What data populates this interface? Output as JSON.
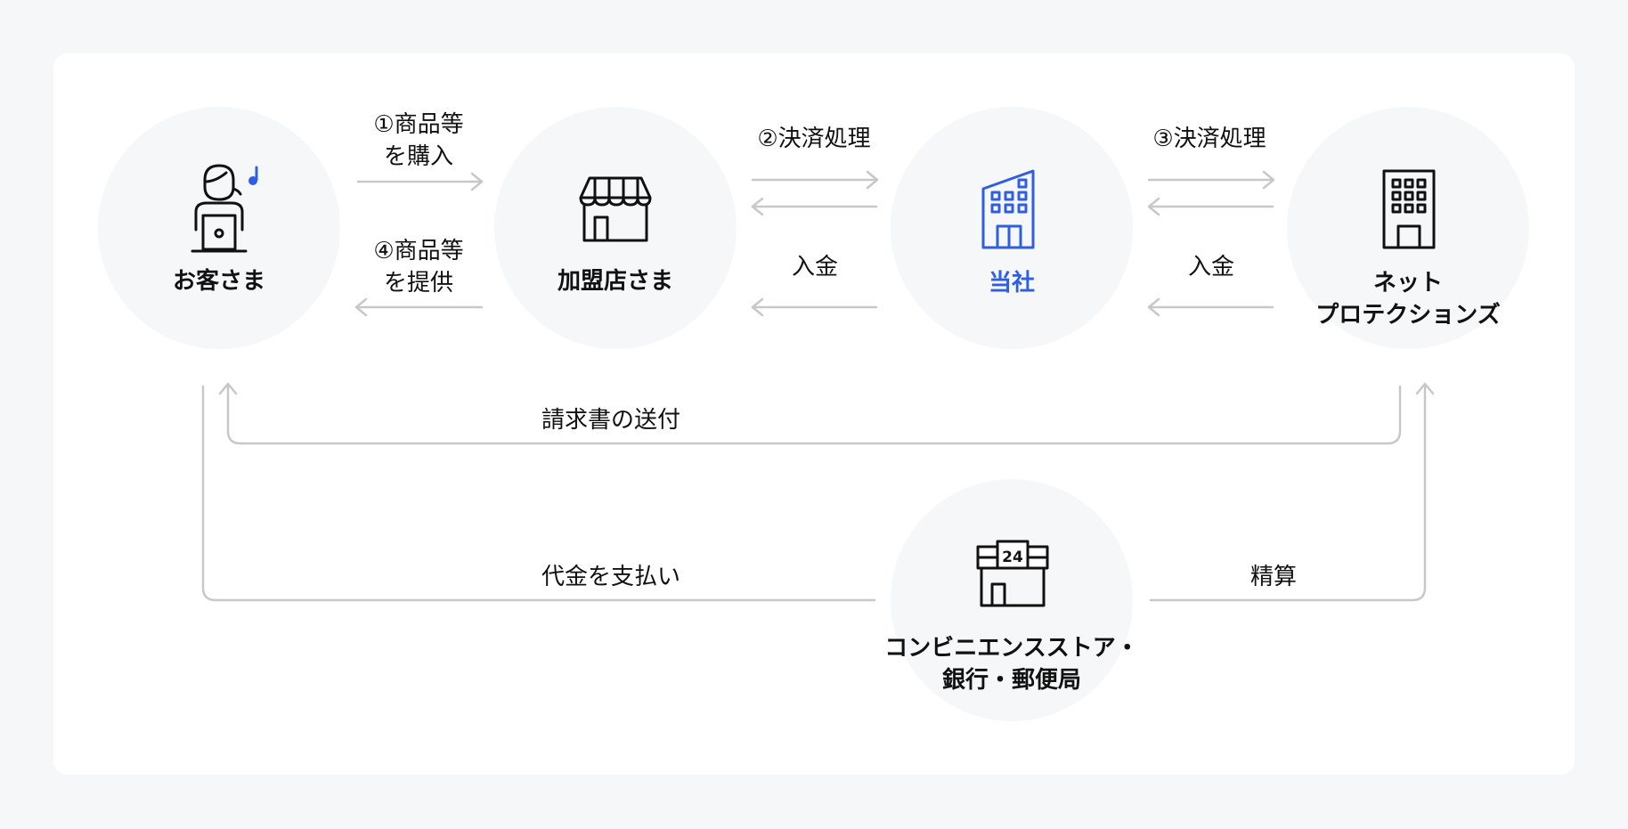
{
  "nodes": {
    "customer": {
      "label": "お客さま",
      "icon": "person-laptop-icon"
    },
    "merchant": {
      "label": "加盟店さま",
      "icon": "storefront-icon"
    },
    "company": {
      "label": "当社",
      "icon": "office-building-icon",
      "color": "#2f5fe0"
    },
    "netprotections": {
      "label_line1": "ネット",
      "label_line2": "プロテクションズ",
      "icon": "building-icon"
    },
    "payment_point": {
      "label_line1": "コンビニエンスストア・",
      "label_line2": "銀行・郵便局",
      "icon": "convenience-store-24-icon",
      "icon_text": "24"
    }
  },
  "flows": {
    "purchase": {
      "line1": "①商品等",
      "line2": "を購入"
    },
    "provide": {
      "line1": "④商品等",
      "line2": "を提供"
    },
    "settlement2": {
      "label": "②決済処理"
    },
    "deposit_merchant": {
      "label": "入金"
    },
    "settlement3": {
      "label": "③決済処理"
    },
    "deposit_company": {
      "label": "入金"
    },
    "invoice": {
      "label": "請求書の送付"
    },
    "payment": {
      "label": "代金を支払い"
    },
    "clearing": {
      "label": "精算"
    }
  },
  "colors": {
    "background": "#f6f7f9",
    "panel": "#ffffff",
    "circle": "#f6f7f9",
    "arrow": "#c8c8c8",
    "accent": "#2f5fe0",
    "text": "#111111"
  }
}
